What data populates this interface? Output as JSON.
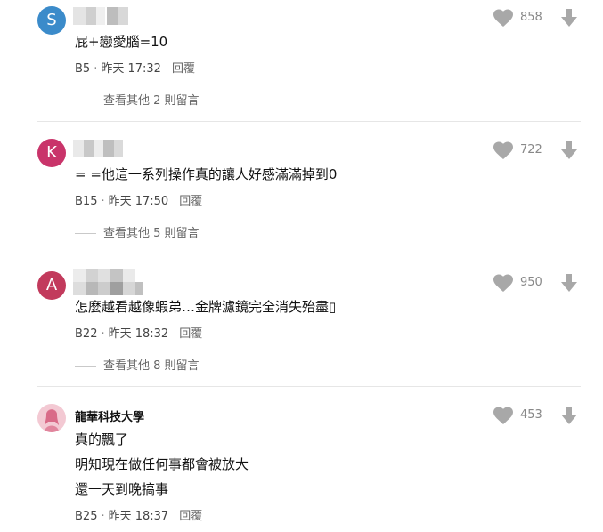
{
  "comments": [
    {
      "avatar_letter": "S",
      "avatar_color": "#3b8bca",
      "text_lines": [
        "屁+戀愛腦=10"
      ],
      "floor": "B5",
      "time": "昨天 17:32",
      "reply_label": "回覆",
      "likes": "858",
      "more_replies": "查看其他 2 則留言"
    },
    {
      "avatar_letter": "K",
      "avatar_color": "#c9346a",
      "text_lines": [
        "= =他這一系列操作真的讓人好感滿滿掉到0"
      ],
      "floor": "B15",
      "time": "昨天 17:50",
      "reply_label": "回覆",
      "likes": "722",
      "more_replies": "查看其他 5 則留言"
    },
    {
      "avatar_letter": "A",
      "avatar_color": "#c23a5c",
      "text_lines": [
        "怎麼越看越像蝦弟…金牌濾鏡完全消失殆盡▯"
      ],
      "floor": "B22",
      "time": "昨天 18:32",
      "reply_label": "回覆",
      "likes": "950",
      "more_replies": "查看其他 8 則留言"
    },
    {
      "author": "龍華科技大學",
      "avatar_color": "#f3c9d3",
      "text_lines": [
        "真的飄了",
        "明知現在做任何事都會被放大",
        "還一天到晚搞事"
      ],
      "floor": "B25",
      "time": "昨天 18:37",
      "reply_label": "回覆",
      "likes": "453"
    }
  ],
  "colors": {
    "icon_gray": "#a8a8a8",
    "divider": "#e6e6e6"
  },
  "icons": {
    "like": "heart-icon",
    "downvote": "arrow-down-icon"
  }
}
